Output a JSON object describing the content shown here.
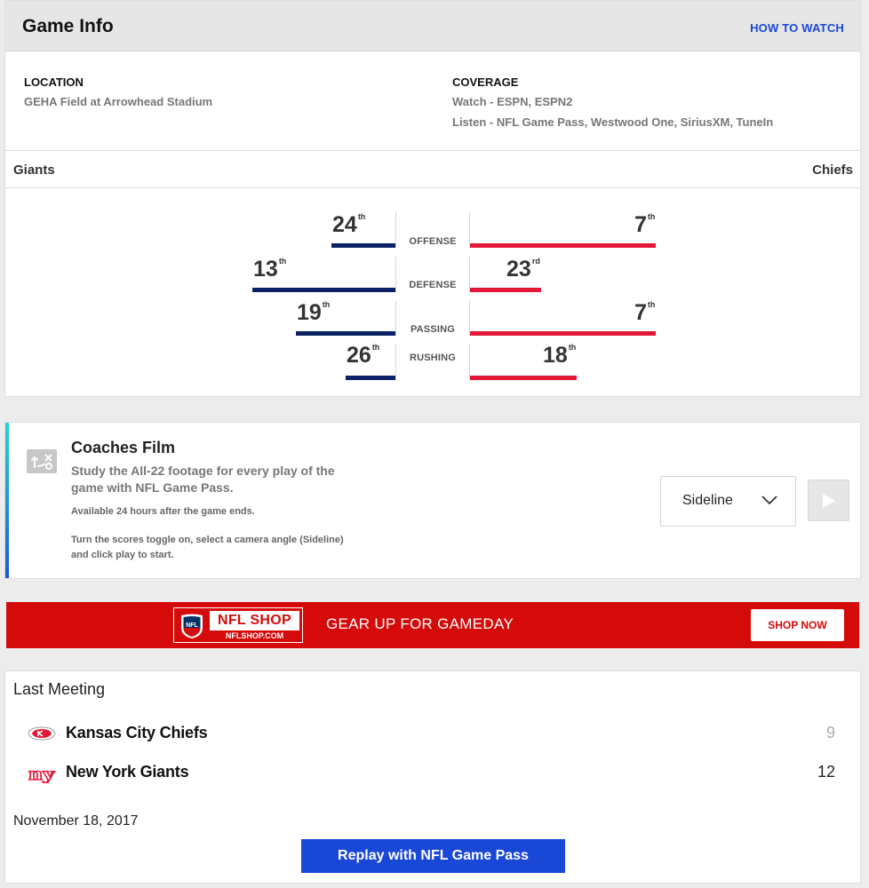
{
  "game_info": {
    "title": "Game Info",
    "how_to_watch": "HOW TO WATCH",
    "location": {
      "label": "LOCATION",
      "value": "GEHA Field at Arrowhead Stadium"
    },
    "coverage": {
      "label": "COVERAGE",
      "watch_label": "Watch -",
      "watch_value": "ESPN, ESPN2",
      "listen_label": "Listen -",
      "listen_value": "NFL Game Pass, Westwood One, SiriusXM, TuneIn"
    },
    "teams": {
      "left": "Giants",
      "right": "Chiefs"
    },
    "colors": {
      "giants": "#0b2265",
      "chiefs": "#e31837"
    },
    "stats": [
      {
        "label": "OFFENSE",
        "giants": {
          "rank": "24",
          "suffix": "th"
        },
        "chiefs": {
          "rank": "7",
          "suffix": "th"
        }
      },
      {
        "label": "DEFENSE",
        "giants": {
          "rank": "13",
          "suffix": "th"
        },
        "chiefs": {
          "rank": "23",
          "suffix": "rd"
        }
      },
      {
        "label": "PASSING",
        "giants": {
          "rank": "19",
          "suffix": "th"
        },
        "chiefs": {
          "rank": "7",
          "suffix": "th"
        }
      },
      {
        "label": "RUSHING",
        "giants": {
          "rank": "26",
          "suffix": "th"
        },
        "chiefs": {
          "rank": "18",
          "suffix": "th"
        }
      }
    ]
  },
  "coaches_film": {
    "title": "Coaches Film",
    "description": "Study the All-22 footage for every play of the game with NFL Game Pass.",
    "availability": "Available 24 hours after the game ends.",
    "instructions_line1": "Turn the scores toggle on, select a camera angle (Sideline)",
    "instructions_line2": "and click play to start.",
    "camera_select": "Sideline",
    "icons": {
      "film": "play-diagram-icon",
      "chevron": "chevron-down-icon",
      "play": "play-icon"
    }
  },
  "shop_banner": {
    "logo_title": "NFL SHOP",
    "logo_url": "NFLSHOP.COM",
    "shield_text": "NFL",
    "tagline": "GEAR UP FOR GAMEDAY",
    "button": "SHOP NOW"
  },
  "last_meeting": {
    "title": "Last Meeting",
    "teams": [
      {
        "name": "Kansas City Chiefs",
        "score": "9",
        "logo": "chiefs-logo-icon"
      },
      {
        "name": "New York Giants",
        "score": "12",
        "logo": "giants-logo-icon"
      }
    ],
    "date": "November 18, 2017",
    "button": "Replay with NFL Game Pass"
  }
}
